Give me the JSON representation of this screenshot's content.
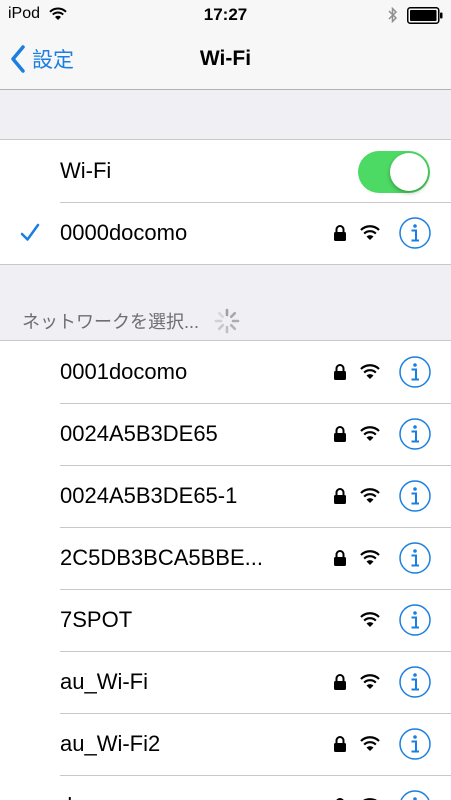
{
  "status_bar": {
    "device": "iPod",
    "time": "17:27"
  },
  "nav": {
    "back_label": "設定",
    "title": "Wi-Fi"
  },
  "wifi_toggle": {
    "label": "Wi-Fi",
    "on": true
  },
  "connected_network": {
    "name": "0000docomo",
    "secured": true
  },
  "section_header": "ネットワークを選択...",
  "networks": [
    {
      "name": "0001docomo",
      "secured": true
    },
    {
      "name": "0024A5B3DE65",
      "secured": true
    },
    {
      "name": "0024A5B3DE65-1",
      "secured": true
    },
    {
      "name": "2C5DB3BCA5BBE...",
      "secured": true
    },
    {
      "name": "7SPOT",
      "secured": false
    },
    {
      "name": "au_Wi-Fi",
      "secured": true
    },
    {
      "name": "au_Wi-Fi2",
      "secured": true
    },
    {
      "name": "d",
      "secured": true
    }
  ],
  "colors": {
    "accent": "#1a7fe0",
    "toggle_on": "#4cd964",
    "background": "#efeff4"
  }
}
